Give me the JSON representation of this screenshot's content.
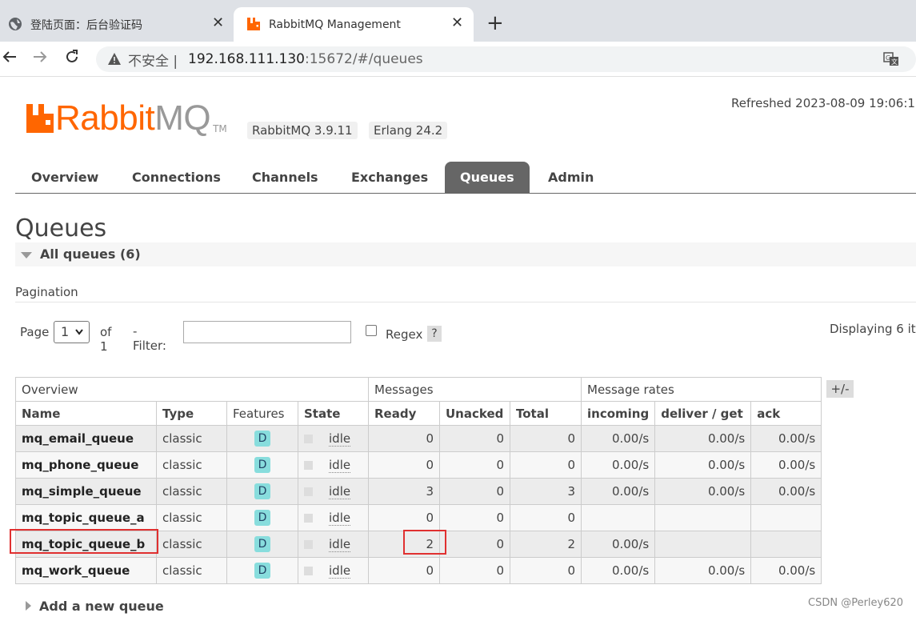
{
  "browser": {
    "tabs": [
      {
        "title": "登陆页面：后台验证码",
        "close": "✕"
      },
      {
        "title": "RabbitMQ Management",
        "close": "✕"
      }
    ],
    "new_tab": "+",
    "address": {
      "insecure_label": "不安全",
      "separator": "|",
      "host": "192.168.111.130",
      "rest": ":15672/#/queues"
    }
  },
  "header": {
    "logo_rabbit": "Rabbit",
    "logo_mq": "MQ",
    "logo_tm": "TM",
    "version": "RabbitMQ 3.9.11",
    "erlang": "Erlang 24.2",
    "refreshed": "Refreshed 2023-08-09 19:06:1"
  },
  "nav": {
    "items": [
      "Overview",
      "Connections",
      "Channels",
      "Exchanges",
      "Queues",
      "Admin"
    ],
    "active": "Queues"
  },
  "page": {
    "title": "Queues",
    "all_queues": "All queues (6)",
    "pagination_title": "Pagination",
    "page_label": "Page",
    "page_value": "1",
    "of_label": "of 1",
    "filter_label": "- Filter:",
    "regex_label": "Regex",
    "help": "?",
    "displaying": "Displaying 6 it",
    "plus_minus": "+/-",
    "add_queue": "Add a new queue"
  },
  "table": {
    "groups": [
      "Overview",
      "Messages",
      "Message rates"
    ],
    "columns": [
      "Name",
      "Type",
      "Features",
      "State",
      "Ready",
      "Unacked",
      "Total",
      "incoming",
      "deliver / get",
      "ack"
    ],
    "rows": [
      {
        "name": "mq_email_queue",
        "type": "classic",
        "feature": "D",
        "state": "idle",
        "ready": "0",
        "unacked": "0",
        "total": "0",
        "incoming": "0.00/s",
        "deliver": "0.00/s",
        "ack": "0.00/s"
      },
      {
        "name": "mq_phone_queue",
        "type": "classic",
        "feature": "D",
        "state": "idle",
        "ready": "0",
        "unacked": "0",
        "total": "0",
        "incoming": "0.00/s",
        "deliver": "0.00/s",
        "ack": "0.00/s"
      },
      {
        "name": "mq_simple_queue",
        "type": "classic",
        "feature": "D",
        "state": "idle",
        "ready": "3",
        "unacked": "0",
        "total": "3",
        "incoming": "0.00/s",
        "deliver": "0.00/s",
        "ack": "0.00/s"
      },
      {
        "name": "mq_topic_queue_a",
        "type": "classic",
        "feature": "D",
        "state": "idle",
        "ready": "0",
        "unacked": "0",
        "total": "0",
        "incoming": "",
        "deliver": "",
        "ack": ""
      },
      {
        "name": "mq_topic_queue_b",
        "type": "classic",
        "feature": "D",
        "state": "idle",
        "ready": "2",
        "unacked": "0",
        "total": "2",
        "incoming": "0.00/s",
        "deliver": "",
        "ack": ""
      },
      {
        "name": "mq_work_queue",
        "type": "classic",
        "feature": "D",
        "state": "idle",
        "ready": "0",
        "unacked": "0",
        "total": "0",
        "incoming": "0.00/s",
        "deliver": "0.00/s",
        "ack": "0.00/s"
      }
    ]
  },
  "watermark": "CSDN @Perley620",
  "colors": {
    "accent": "#ff6600",
    "nav_active": "#666666",
    "highlight": "#e03030"
  }
}
